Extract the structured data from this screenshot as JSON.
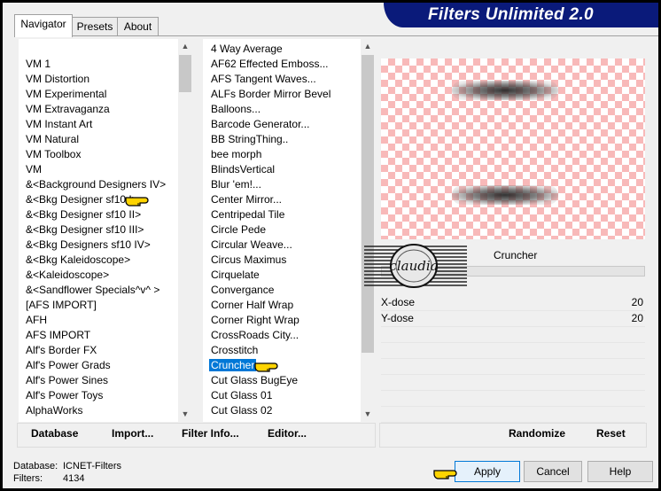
{
  "app": {
    "title": "Filters Unlimited 2.0"
  },
  "tabs": [
    {
      "label": "Navigator"
    },
    {
      "label": "Presets"
    },
    {
      "label": "About"
    }
  ],
  "categories": [
    {
      "label": "VM 1"
    },
    {
      "label": "VM Distortion"
    },
    {
      "label": "VM Experimental"
    },
    {
      "label": "VM Extravaganza"
    },
    {
      "label": "VM Instant Art"
    },
    {
      "label": "VM Natural"
    },
    {
      "label": "VM Toolbox"
    },
    {
      "label": "VM"
    },
    {
      "label": "&<Background Designers IV>"
    },
    {
      "label": "&<Bkg Designer sf10 I>"
    },
    {
      "label": "&<Bkg Designer sf10 II>"
    },
    {
      "label": "&<Bkg Designer sf10 III>"
    },
    {
      "label": "&<Bkg Designers sf10 IV>"
    },
    {
      "label": "&<Bkg Kaleidoscope>"
    },
    {
      "label": "&<Kaleidoscope>"
    },
    {
      "label": "&<Sandflower Specials^v^ >"
    },
    {
      "label": "[AFS IMPORT]"
    },
    {
      "label": "AFH"
    },
    {
      "label": "AFS IMPORT"
    },
    {
      "label": "Alf's Border FX"
    },
    {
      "label": "Alf's Power Grads"
    },
    {
      "label": "Alf's Power Sines"
    },
    {
      "label": "Alf's Power Toys"
    },
    {
      "label": "AlphaWorks"
    }
  ],
  "filters": [
    {
      "label": "4 Way Average"
    },
    {
      "label": "AF62 Effected Emboss..."
    },
    {
      "label": "AFS Tangent Waves..."
    },
    {
      "label": "ALFs Border Mirror Bevel"
    },
    {
      "label": "Balloons..."
    },
    {
      "label": "Barcode Generator..."
    },
    {
      "label": "BB StringThing.."
    },
    {
      "label": "bee morph"
    },
    {
      "label": "BlindsVertical"
    },
    {
      "label": "Blur 'em!..."
    },
    {
      "label": "Center Mirror..."
    },
    {
      "label": "Centripedal Tile"
    },
    {
      "label": "Circle Pede"
    },
    {
      "label": "Circular Weave..."
    },
    {
      "label": "Circus Maximus"
    },
    {
      "label": "Cirquelate"
    },
    {
      "label": "Convergance"
    },
    {
      "label": "Corner Half Wrap"
    },
    {
      "label": "Corner Right Wrap"
    },
    {
      "label": "CrossRoads City..."
    },
    {
      "label": "Crosstitch"
    },
    {
      "label": "Cruncher"
    },
    {
      "label": "Cut Glass  BugEye"
    },
    {
      "label": "Cut Glass 01"
    },
    {
      "label": "Cut Glass 02"
    }
  ],
  "selected_filter": "Cruncher",
  "params": [
    {
      "name": "X-dose",
      "value": "20"
    },
    {
      "name": "Y-dose",
      "value": "20"
    }
  ],
  "watermark": {
    "text": "claudia"
  },
  "toolbar_left": {
    "database": "Database",
    "import": "Import...",
    "filter_info": "Filter Info...",
    "editor": "Editor..."
  },
  "toolbar_right": {
    "randomize": "Randomize",
    "reset": "Reset"
  },
  "status": {
    "database_label": "Database:",
    "database_value": "ICNET-Filters",
    "filters_label": "Filters:",
    "filters_value": "4134"
  },
  "buttons": {
    "apply": "Apply",
    "cancel": "Cancel",
    "help": "Help"
  },
  "colors": {
    "banner": "#0a1a7a",
    "selection": "#0078d7",
    "checker": "#f8b9b9"
  },
  "icons": [
    "pointing-hand-icon",
    "scroll-up-arrow-icon",
    "scroll-down-arrow-icon"
  ]
}
